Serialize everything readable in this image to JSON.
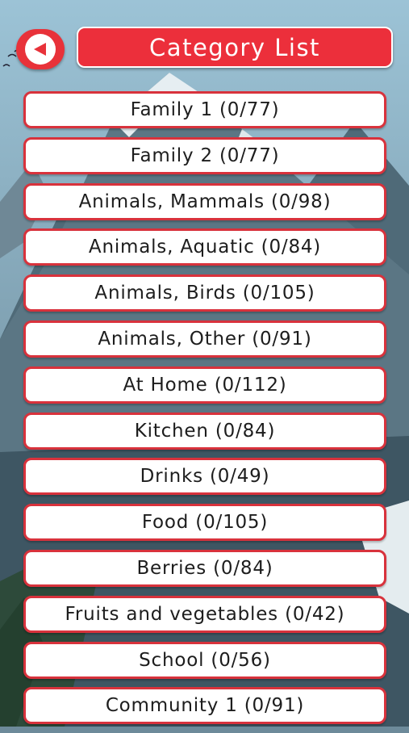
{
  "header": {
    "title": "Category List",
    "back_icon": "back-arrow-icon"
  },
  "categories": [
    {
      "label": "Family 1 (0/77)"
    },
    {
      "label": "Family 2 (0/77)"
    },
    {
      "label": "Animals, Mammals (0/98)"
    },
    {
      "label": "Animals, Aquatic (0/84)"
    },
    {
      "label": "Animals, Birds (0/105)"
    },
    {
      "label": "Animals, Other (0/91)"
    },
    {
      "label": "At Home (0/112)"
    },
    {
      "label": "Kitchen (0/84)"
    },
    {
      "label": "Drinks (0/49)"
    },
    {
      "label": "Food (0/105)"
    },
    {
      "label": "Berries (0/84)"
    },
    {
      "label": "Fruits and vegetables (0/42)"
    },
    {
      "label": "School (0/56)"
    },
    {
      "label": "Community 1 (0/91)"
    }
  ],
  "colors": {
    "accent_red": "#ec2f3b",
    "button_border": "#d8323c",
    "button_fill": "#ffffff"
  }
}
